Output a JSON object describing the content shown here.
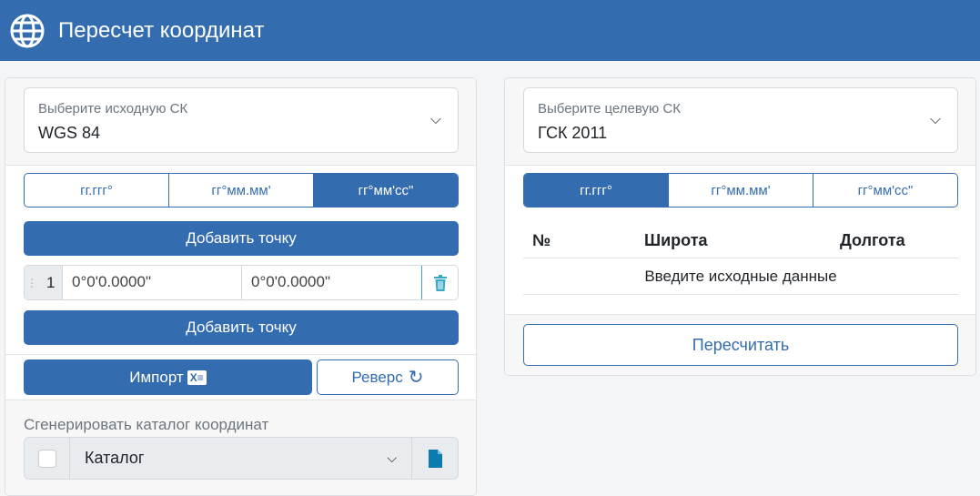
{
  "header": {
    "title": "Пересчет координат",
    "icon": "globe-icon"
  },
  "source": {
    "select_label": "Выберите исходную СК",
    "select_value": "WGS 84",
    "formats": [
      "гг.ггг°",
      "гг°мм.мм'",
      "гг°мм'сс\""
    ],
    "active_format": 2,
    "add_point": "Добавить точку",
    "points": [
      {
        "num": "1",
        "lat": "0°0'0.0000\"",
        "lon": "0°0'0.0000\""
      }
    ],
    "import": "Импорт",
    "reverse": "Реверс",
    "catalog_label": "Сгенерировать каталог координат",
    "catalog_value": "Каталог"
  },
  "target": {
    "select_label": "Выберите целевую СК",
    "select_value": "ГСК 2011",
    "formats": [
      "гг.ггг°",
      "гг°мм.мм'",
      "гг°мм'сс\""
    ],
    "active_format": 0,
    "columns": [
      "№",
      "Широта",
      "Долгота"
    ],
    "empty": "Введите исходные данные",
    "recalc": "Пересчитать"
  },
  "colors": {
    "primary": "#346cb0",
    "file_icon": "#0e7bb0",
    "trash": "#3aa8c8"
  }
}
